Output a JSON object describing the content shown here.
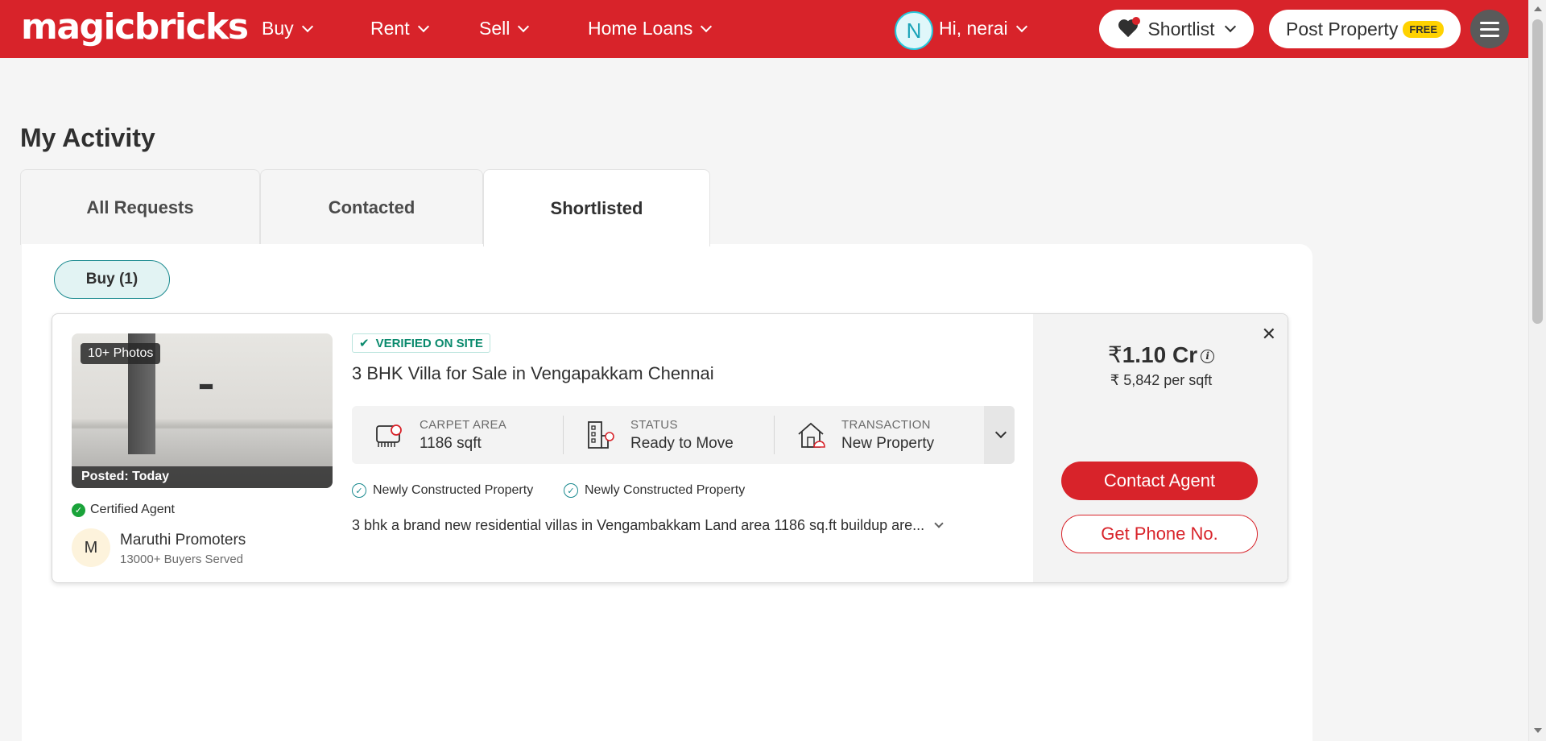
{
  "header": {
    "logo": "magicbricks",
    "nav": [
      {
        "label": "Buy"
      },
      {
        "label": "Rent"
      },
      {
        "label": "Sell"
      },
      {
        "label": "Home Loans"
      }
    ],
    "avatar_initial": "N",
    "greeting": "Hi, nerai",
    "shortlist_label": "Shortlist",
    "post_property_label": "Post Property",
    "free_badge": "FREE",
    "brand_color": "#d8232a"
  },
  "page": {
    "title": "My Activity",
    "tabs": [
      {
        "label": "All Requests",
        "active": false
      },
      {
        "label": "Contacted",
        "active": false
      },
      {
        "label": "Shortlisted",
        "active": true
      }
    ],
    "filter_chip": "Buy (1)"
  },
  "listing": {
    "photos_badge": "10+ Photos",
    "posted": "Posted: Today",
    "certified_label": "Certified Agent",
    "agent_initial": "M",
    "agent_name": "Maruthi Promoters",
    "agent_served": "13000+ Buyers Served",
    "verified_label": "VERIFIED ON SITE",
    "title": "3 BHK Villa for Sale in Vengapakkam Chennai",
    "summary": [
      {
        "label": "CARPET AREA",
        "value": "1186 sqft",
        "icon": "carpet-area-icon"
      },
      {
        "label": "STATUS",
        "value": "Ready to Move",
        "icon": "building-status-icon"
      },
      {
        "label": "TRANSACTION",
        "value": "New Property",
        "icon": "house-transaction-icon"
      }
    ],
    "tags": [
      "Newly Constructed Property",
      "Newly Constructed Property"
    ],
    "description": "3 bhk a brand new residential villas in Vengambakkam Land area 1186 sq.ft buildup are...",
    "price_symbol": "₹",
    "price": "1.10 Cr",
    "per_sqft": "₹ 5,842 per sqft",
    "contact_label": "Contact Agent",
    "phone_label": "Get Phone No."
  }
}
